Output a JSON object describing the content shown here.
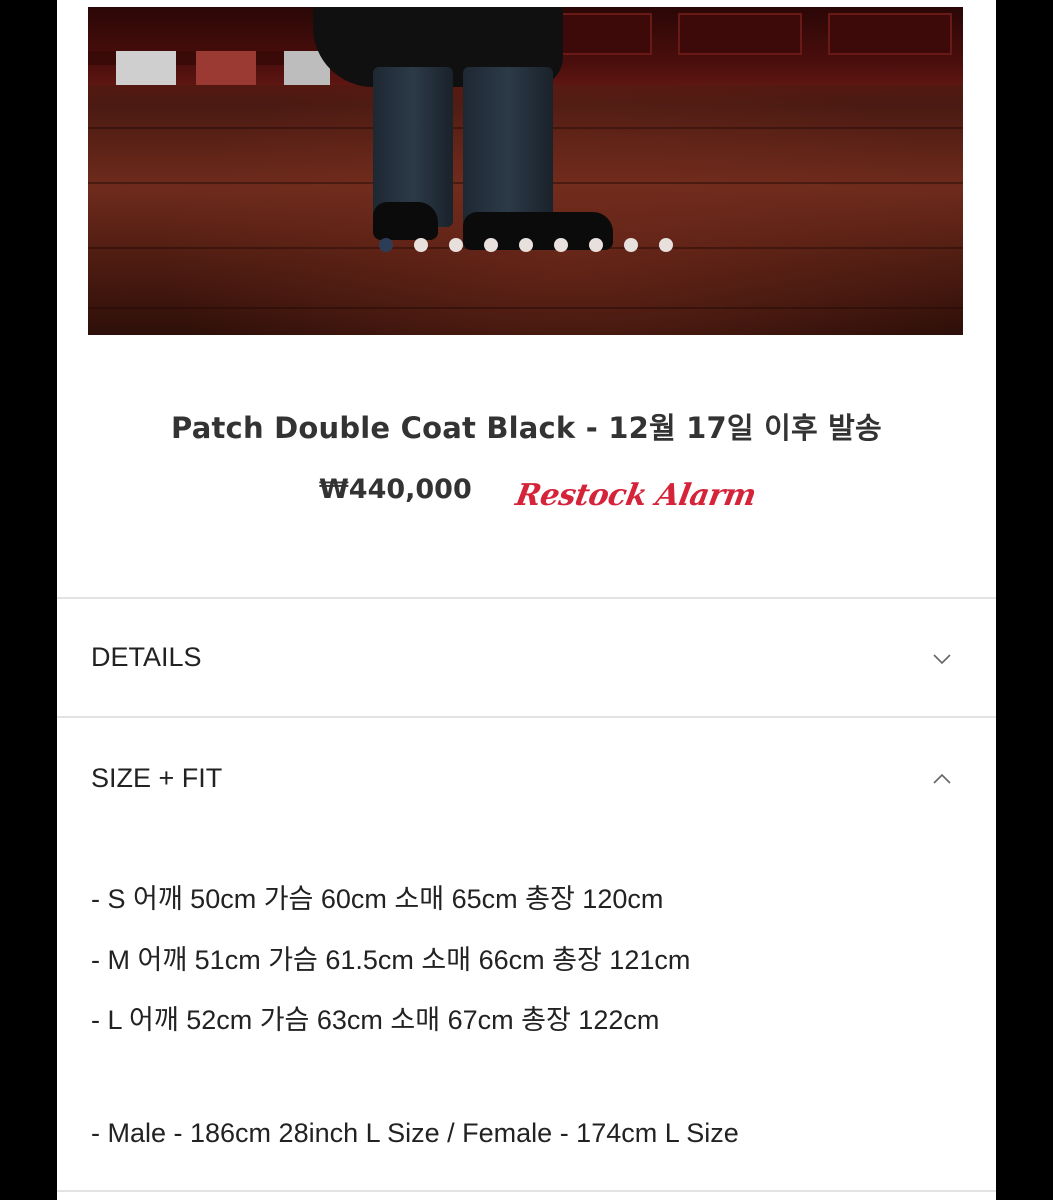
{
  "product": {
    "title": "Patch Double Coat Black - 12월 17일 이후 발송",
    "price": "₩440,000",
    "restock_label": "Restock Alarm"
  },
  "gallery": {
    "slide_count": 9,
    "active_index": 0
  },
  "accordion": {
    "details_label": "DETAILS",
    "size_fit_label": "SIZE + FIT"
  },
  "size_fit": {
    "lines": [
      "- S 어깨 50cm 가슴 60cm 소매 65cm 총장 120cm",
      "- M 어깨 51cm 가슴 61.5cm 소매 66cm 총장 121cm",
      "- L 어깨 52cm 가슴 63cm 소매 67cm 총장 122cm"
    ],
    "model_info": "- Male - 186cm 28inch L Size / Female - 174cm L Size"
  },
  "colors": {
    "restock": "#d5233a",
    "active_dot": "#2c3d58"
  }
}
